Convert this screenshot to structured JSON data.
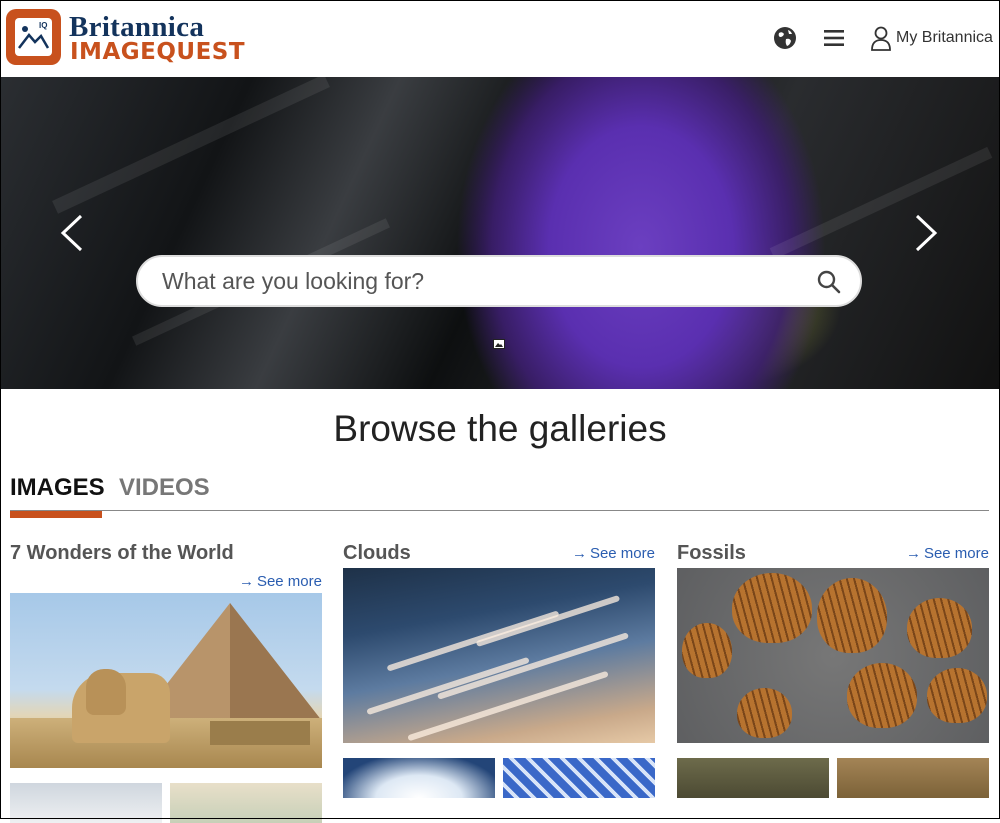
{
  "header": {
    "brand_line1": "Britannica",
    "brand_line2": "IMAGEQUEST",
    "brand_badge_small": "IQ",
    "globe_icon": "globe-icon",
    "menu_icon": "hamburger-menu-icon",
    "account_label": "My Britannica",
    "account_icon": "user-icon",
    "colors": {
      "brand_orange": "#c8511d",
      "brand_navy": "#13335c"
    }
  },
  "hero": {
    "search_placeholder": "What are you looking for?",
    "search_icon": "search-icon",
    "prev_icon": "chevron-left-icon",
    "next_icon": "chevron-right-icon"
  },
  "browse": {
    "title": "Browse the galleries",
    "tabs": [
      {
        "label": "IMAGES",
        "active": true
      },
      {
        "label": "VIDEOS",
        "active": false
      }
    ],
    "galleries": [
      {
        "title": "7 Wonders of the World",
        "see_more": "See more"
      },
      {
        "title": "Clouds",
        "see_more": "See more"
      },
      {
        "title": "Fossils",
        "see_more": "See more"
      }
    ],
    "link_color": "#2a5db0"
  }
}
